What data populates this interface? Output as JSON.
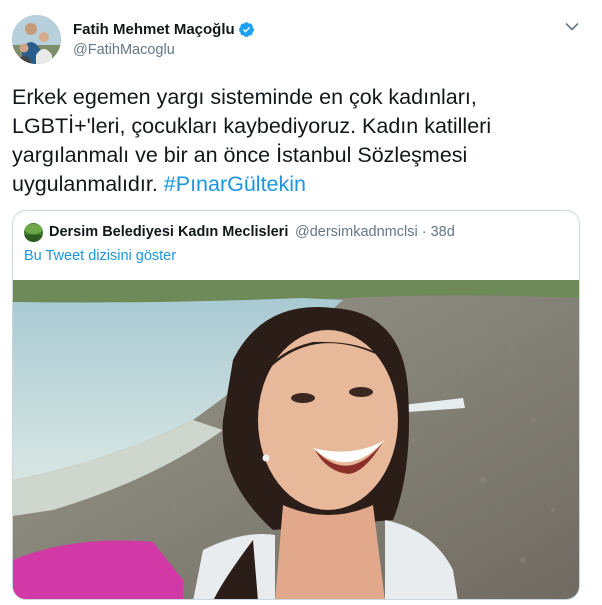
{
  "tweet": {
    "author_name": "Fatih Mehmet Maçoğlu",
    "author_handle": "@FatihMacoglu",
    "text_plain": "Erkek egemen yargı sisteminde en çok kadınları,\nLGBTİ+'leri, çocukları kaybediyoruz. Kadın katilleri\nyargılanmalı ve  bir an önce İstanbul Sözleşmesi\nuygulanmalıdır. ",
    "hashtag": "#PınarGültekin",
    "verified_icon": "verified-badge-icon",
    "menu_icon": "chevron-down-icon"
  },
  "quote": {
    "author_name": "Dersim Belediyesi Kadın Meclisleri",
    "author_handle": "@dersimkadnmclsi",
    "separator": "·",
    "time": "38d",
    "show_thread": "Bu Tweet dizisini göster"
  },
  "colors": {
    "link": "#1b95e0",
    "secondary_text": "#657786",
    "border": "#ccd6dd",
    "verified": "#1da1f2"
  }
}
